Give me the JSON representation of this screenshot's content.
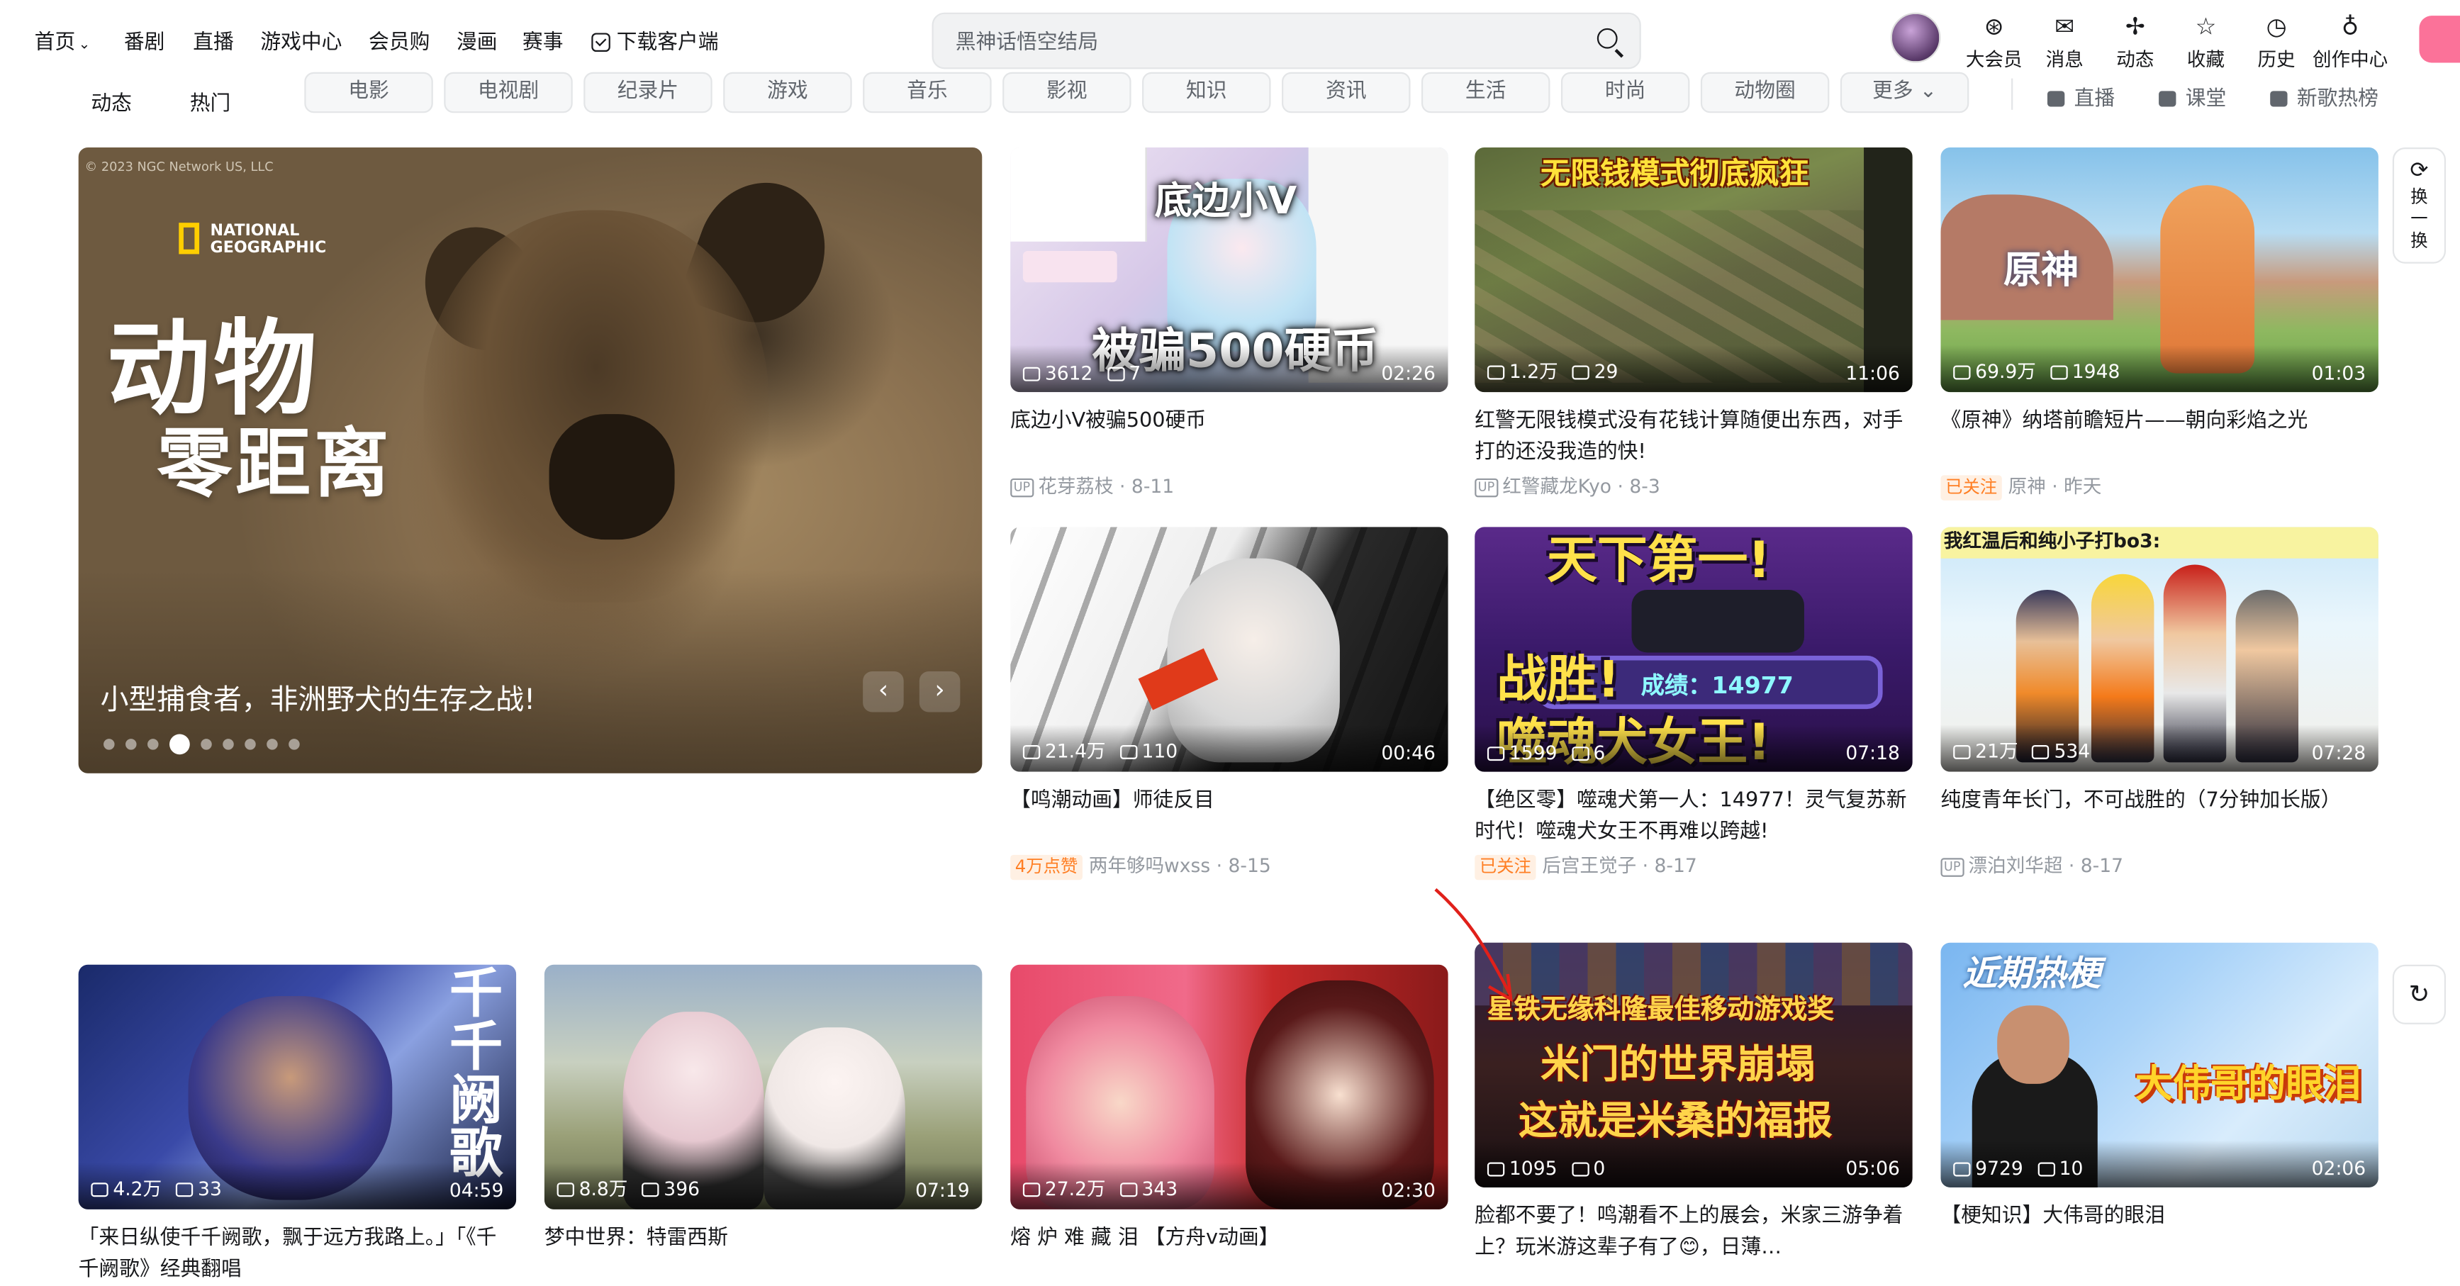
{
  "nav": {
    "home": "首页",
    "items": [
      "番剧",
      "直播",
      "游戏中心",
      "会员购",
      "漫画",
      "赛事"
    ],
    "download": "下载客户端"
  },
  "search": {
    "placeholder": "黑神话悟空结局"
  },
  "user_menu": [
    "大会员",
    "消息",
    "动态",
    "收藏",
    "历史",
    "创作中心"
  ],
  "channels": {
    "tabs": [
      "动态",
      "热门"
    ],
    "pills": [
      "电影",
      "电视剧",
      "纪录片",
      "游戏",
      "音乐",
      "影视",
      "知识",
      "资讯",
      "生活",
      "时尚",
      "动物圈",
      "更多"
    ],
    "side": [
      "直播",
      "课堂",
      "新歌热榜"
    ]
  },
  "hero": {
    "copyright": "© 2023 NGC Network US, LLC",
    "brand": "NATIONAL GEOGRAPHIC",
    "headline1": "动物",
    "headline2": "零距离",
    "caption": "小型捕食者，非洲野犬的生存之战!",
    "active_dot": 3,
    "dot_count": 9
  },
  "float": {
    "refresh": "换一换"
  },
  "videos": [
    {
      "views": "3612",
      "danmaku": "7",
      "duration": "02:26",
      "title": "底边小V被骗500硬币",
      "tag": "",
      "up": "花芽荔枝",
      "date": "8-11",
      "overlay": "被骗500硬币",
      "overlay2": "底边小V"
    },
    {
      "views": "1.2万",
      "danmaku": "29",
      "duration": "11:06",
      "title": "红警无限钱模式没有花钱计算随便出东西，对手打的还没我造的快!",
      "tag": "",
      "up": "红警藏龙Kyo",
      "date": "8-3",
      "overlay": "无限钱模式彻底疯狂"
    },
    {
      "views": "69.9万",
      "danmaku": "1948",
      "duration": "01:03",
      "title": "《原神》纳塔前瞻短片——朝向彩焰之光",
      "tag": "已关注",
      "up": "原神",
      "date": "昨天",
      "overlay": "原神"
    },
    {
      "views": "21.4万",
      "danmaku": "110",
      "duration": "00:46",
      "title": "【鸣潮动画】师徒反目",
      "tag": "4万点赞",
      "up": "两年够吗wxss",
      "date": "8-15"
    },
    {
      "views": "1599",
      "danmaku": "6",
      "duration": "07:18",
      "title": "【绝区零】噬魂犬第一人：14977！灵气复苏新时代！噬魂犬女王不再难以跨越!",
      "tag": "已关注",
      "up": "后宫王觉子",
      "date": "8-17",
      "overlay": "天下第一!",
      "overlay2": "战胜!",
      "overlay3": "噬魂犬女王!",
      "overlay4": "成绩：14977"
    },
    {
      "views": "21万",
      "danmaku": "534",
      "duration": "07:28",
      "title": "纯度青年长门，不可战胜的（7分钟加长版）",
      "tag": "",
      "up": "漂泊刘华超",
      "date": "8-17",
      "overlay": "我红温后和纯小子打bo3:"
    },
    {
      "views": "4.2万",
      "danmaku": "33",
      "duration": "04:59",
      "title": "「来日纵使千千阙歌，飘于远方我路上。」「《千千阙歌》经典翻唱",
      "tag": "",
      "up": "",
      "date": "",
      "overlay": "千千阙歌"
    },
    {
      "views": "8.8万",
      "danmaku": "396",
      "duration": "07:19",
      "title": "梦中世界：特雷西斯",
      "tag": "",
      "up": "",
      "date": ""
    },
    {
      "views": "27.2万",
      "danmaku": "343",
      "duration": "02:30",
      "title": "熔 炉 难 藏 泪 【方舟v动画】",
      "tag": "",
      "up": "",
      "date": ""
    },
    {
      "views": "1095",
      "danmaku": "0",
      "duration": "05:06",
      "title": "脸都不要了！鸣潮看不上的展会，米家三游争着上？玩米游这辈子有了😊，日薄…",
      "tag": "",
      "up": "",
      "date": "",
      "overlay": "星铁无缘科隆最佳移动游戏奖",
      "overlay2": "米门的世界崩塌",
      "overlay3": "这就是米桑的福报"
    },
    {
      "views": "9729",
      "danmaku": "10",
      "duration": "02:06",
      "title": "【梗知识】大伟哥的眼泪",
      "tag": "",
      "up": "",
      "date": "",
      "overlay": "近期热梗",
      "overlay2": "大伟哥的眼泪"
    }
  ]
}
